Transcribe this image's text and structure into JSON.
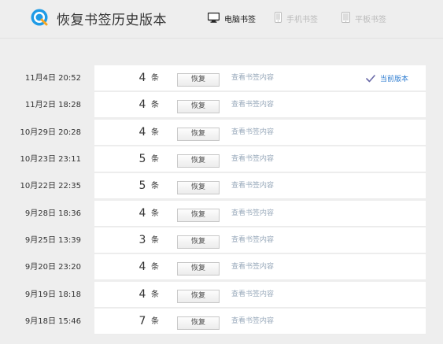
{
  "header": {
    "title": "恢复书签历史版本",
    "tabs": [
      {
        "label": "电脑书签",
        "active": true,
        "icon": "monitor-icon"
      },
      {
        "label": "手机书签",
        "active": false,
        "icon": "phone-icon"
      },
      {
        "label": "平板书签",
        "active": false,
        "icon": "tablet-icon"
      }
    ]
  },
  "versions": [
    {
      "date": "11月4日 20:52",
      "count": "4",
      "unit": "条",
      "restore": "恢复",
      "view": "查看书签内容",
      "current": "当前版本"
    },
    {
      "date": "11月2日 18:28",
      "count": "4",
      "unit": "条",
      "restore": "恢复",
      "view": "查看书签内容"
    },
    {
      "date": "10月29日 20:28",
      "count": "4",
      "unit": "条",
      "restore": "恢复",
      "view": "查看书签内容"
    },
    {
      "date": "10月23日 23:11",
      "count": "5",
      "unit": "条",
      "restore": "恢复",
      "view": "查看书签内容"
    },
    {
      "date": "10月22日 22:35",
      "count": "5",
      "unit": "条",
      "restore": "恢复",
      "view": "查看书签内容"
    },
    {
      "date": "9月28日 18:36",
      "count": "4",
      "unit": "条",
      "restore": "恢复",
      "view": "查看书签内容"
    },
    {
      "date": "9月25日 13:39",
      "count": "3",
      "unit": "条",
      "restore": "恢复",
      "view": "查看书签内容"
    },
    {
      "date": "9月20日 23:20",
      "count": "4",
      "unit": "条",
      "restore": "恢复",
      "view": "查看书签内容"
    },
    {
      "date": "9月19日 18:18",
      "count": "4",
      "unit": "条",
      "restore": "恢复",
      "view": "查看书签内容"
    },
    {
      "date": "9月18日 15:46",
      "count": "7",
      "unit": "条",
      "restore": "恢复",
      "view": "查看书签内容"
    }
  ],
  "colors": {
    "accent": "#2f7dd1",
    "link": "#99aabb",
    "background": "#eeeeee",
    "card": "#ffffff"
  }
}
